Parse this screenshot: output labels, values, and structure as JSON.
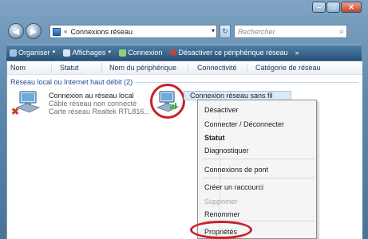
{
  "address": {
    "path": "Connexions réseau",
    "arrows": "«"
  },
  "search": {
    "placeholder": "Rechercher"
  },
  "toolbar": {
    "organize": "Organiser",
    "views": "Affichages",
    "connect": "Connexion",
    "disable": "Désactiver ce périphérique réseau",
    "more": "»"
  },
  "columns": [
    "Nom",
    "Statut",
    "Nom du périphérique",
    "Connectivité",
    "Catégorie de réseau"
  ],
  "group": {
    "title": "Réseau local ou Internet haut débit (2)"
  },
  "items": [
    {
      "name": "Connexion au réseau local",
      "status": "Câble réseau non connecté",
      "device": "Carte réseau Realtek RTL816..."
    },
    {
      "name": "Connexion réseau sans fil"
    }
  ],
  "context_menu": {
    "items": [
      {
        "label": "Désactiver"
      },
      {
        "label": "Connecter / Déconnecter"
      },
      {
        "label": "Statut"
      },
      {
        "label": "Diagnostiquer"
      },
      {
        "label": "Connexions de pont"
      },
      {
        "label": "Créer un raccourci"
      },
      {
        "label": "Supprimer"
      },
      {
        "label": "Renommer"
      },
      {
        "label": "Propriétés"
      }
    ]
  },
  "colors": {
    "highlight_circle": "#c8202c",
    "toolbar": "#2a5479",
    "group_text": "#1e4c8f"
  }
}
